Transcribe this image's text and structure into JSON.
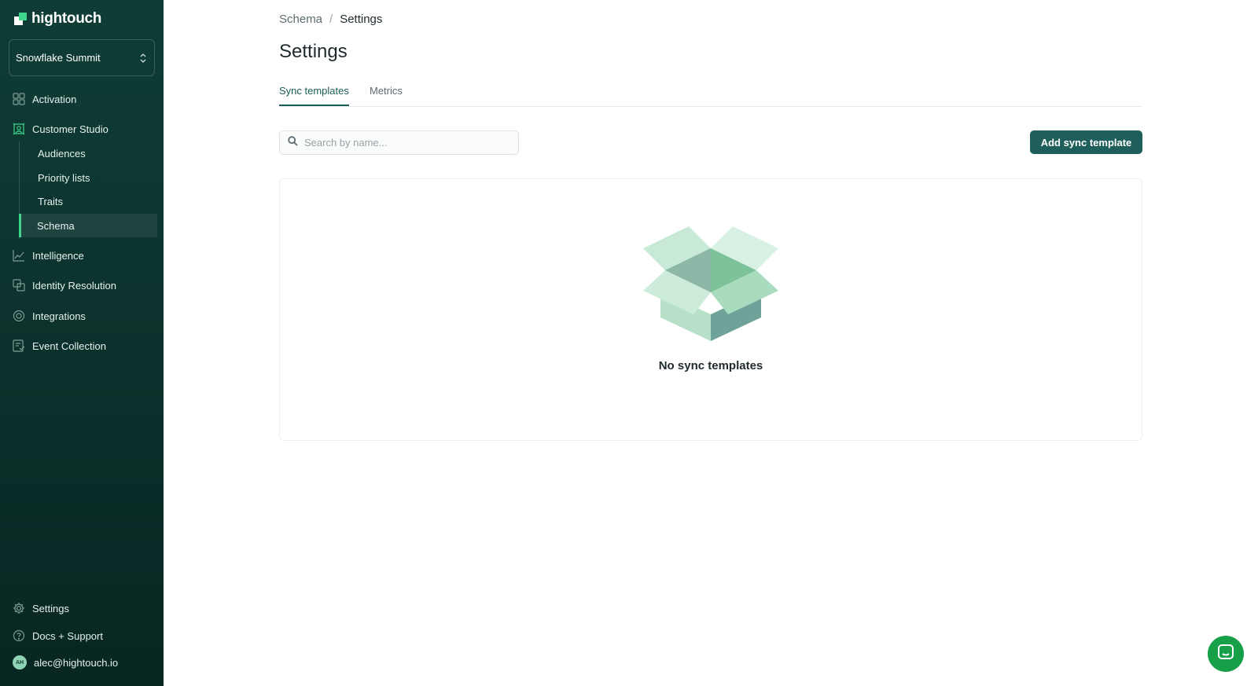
{
  "app": {
    "logo_text": "hightouch"
  },
  "workspace": {
    "name": "Snowflake Summit"
  },
  "sidebar": {
    "items": [
      {
        "label": "Activation",
        "icon": "activation-icon"
      },
      {
        "label": "Customer Studio",
        "icon": "customer-studio-icon"
      },
      {
        "label": "Intelligence",
        "icon": "intelligence-icon"
      },
      {
        "label": "Identity Resolution",
        "icon": "identity-resolution-icon"
      },
      {
        "label": "Integrations",
        "icon": "integrations-icon"
      },
      {
        "label": "Event Collection",
        "icon": "event-collection-icon"
      }
    ],
    "customer_studio_children": [
      {
        "label": "Audiences"
      },
      {
        "label": "Priority lists"
      },
      {
        "label": "Traits"
      },
      {
        "label": "Schema",
        "active": true
      }
    ],
    "footer": {
      "settings_label": "Settings",
      "docs_label": "Docs + Support",
      "user_email": "alec@hightouch.io",
      "avatar_initials": "AH"
    }
  },
  "breadcrumb": {
    "parent": "Schema",
    "separator": "/",
    "current": "Settings"
  },
  "page": {
    "title": "Settings"
  },
  "tabs": [
    {
      "label": "Sync templates",
      "active": true
    },
    {
      "label": "Metrics",
      "active": false
    }
  ],
  "search": {
    "placeholder": "Search by name...",
    "value": ""
  },
  "actions": {
    "add_label": "Add sync template"
  },
  "empty_state": {
    "message": "No sync templates",
    "illustration": "open-box-icon"
  },
  "colors": {
    "sidebar_bg": "#0f3d36",
    "accent": "#3fd68b",
    "primary_button": "#1f5f5b",
    "active_tab": "#1a5c56",
    "chat_button": "#18a048"
  }
}
